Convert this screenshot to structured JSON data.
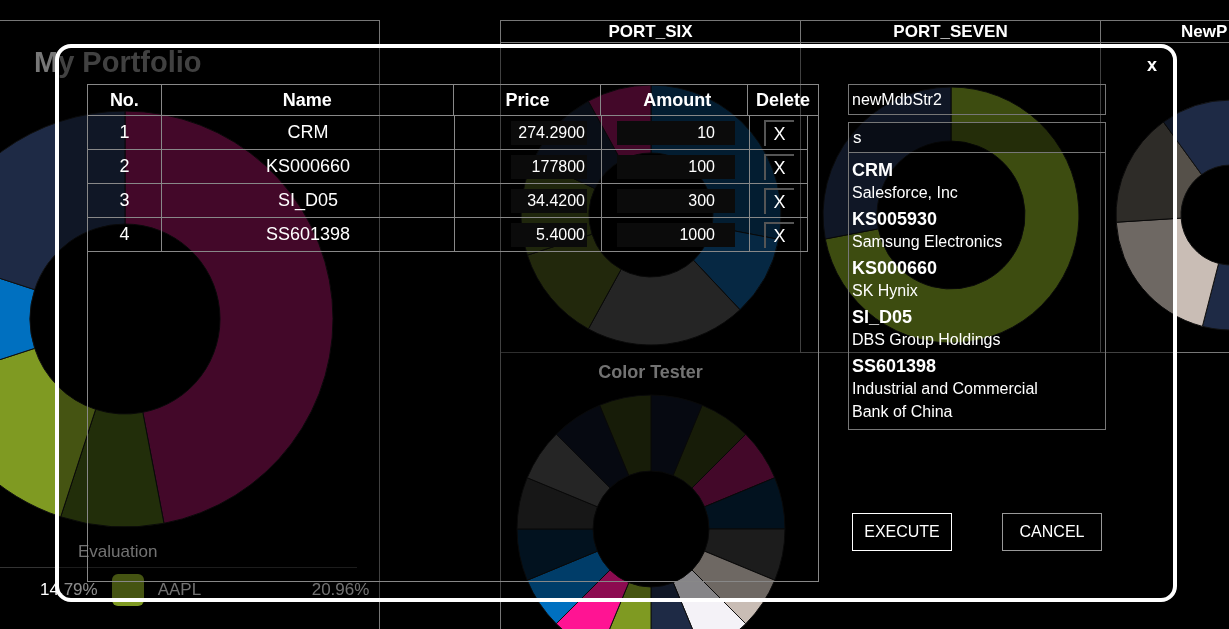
{
  "dashboard": {
    "portfolio_title": "My Portfolio",
    "panel_titles": [
      "PORT_SIX",
      "PORT_SEVEN",
      "NewP"
    ],
    "color_tester_title": "Color Tester",
    "evaluation": {
      "label": "Evaluation",
      "legend": [
        {
          "value": "14.79%"
        },
        {
          "color": "#7f9a22",
          "name": "AAPL",
          "value": "20.96%"
        }
      ]
    }
  },
  "dialog": {
    "close": "x",
    "table": {
      "columns": [
        "No.",
        "Name",
        "Price",
        "Amount",
        "Delete"
      ],
      "rows": [
        {
          "no": "1",
          "name": "CRM",
          "price": "274.2900",
          "amount": "10",
          "delete": "X"
        },
        {
          "no": "2",
          "name": "KS000660",
          "price": "177800",
          "amount": "100",
          "delete": "X"
        },
        {
          "no": "3",
          "name": "SI_D05",
          "price": "34.4200",
          "amount": "300",
          "delete": "X"
        },
        {
          "no": "4",
          "name": "SS601398",
          "price": "5.4000",
          "amount": "1000",
          "delete": "X"
        }
      ]
    },
    "name_field": {
      "value": "newMdbStr2"
    },
    "search_field": {
      "value": "s"
    },
    "results": [
      {
        "code": "CRM",
        "name": "Salesforce, Inc"
      },
      {
        "code": "KS005930",
        "name": "Samsung Electronics"
      },
      {
        "code": "KS000660",
        "name": "SK Hynix"
      },
      {
        "code": "SI_D05",
        "name": "DBS Group Holdings"
      },
      {
        "code": "SS601398",
        "name": "Industrial and Commercial Bank of China"
      }
    ],
    "buttons": [
      "EXECUTE",
      "CANCEL"
    ]
  }
}
